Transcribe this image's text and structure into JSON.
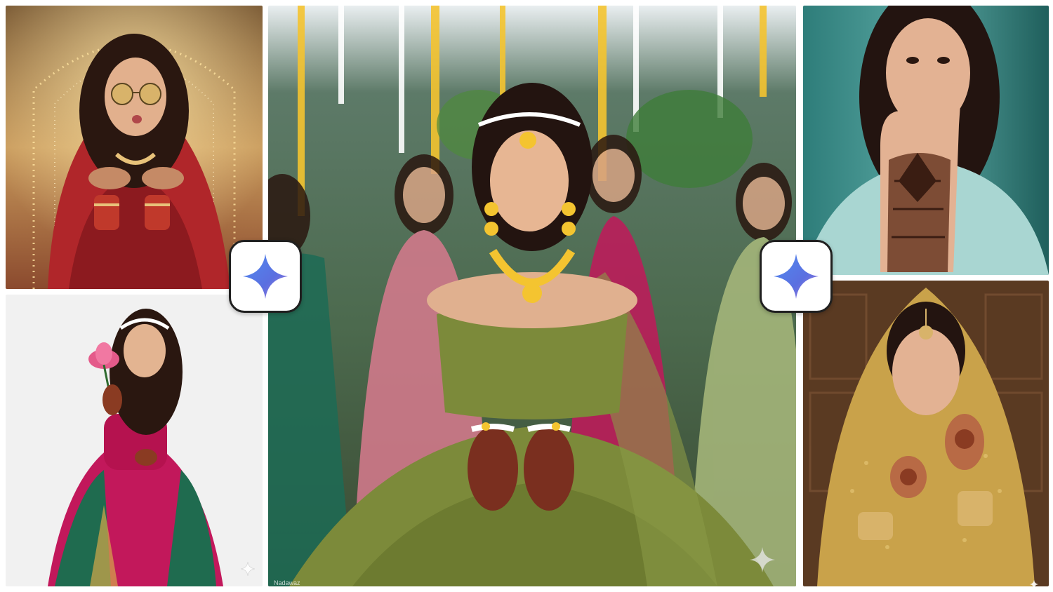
{
  "collage": {
    "photos": [
      {
        "subject": "bride-sunglasses-blowing-kiss",
        "palette": [
          "#b0262a",
          "#e8c27a",
          "#3a1d12"
        ]
      },
      {
        "subject": "bride-holding-lotus",
        "palette": [
          "#c2185b",
          "#1f6b4f",
          "#f2f2f2"
        ]
      },
      {
        "subject": "bride-olive-lehenga-showing-henna",
        "palette": [
          "#7c8a3a",
          "#f4c430",
          "#3d5a3b"
        ]
      },
      {
        "subject": "woman-showing-henna-hand",
        "palette": [
          "#a9d6d2",
          "#2e7d7a",
          "#6b3a25"
        ]
      },
      {
        "subject": "bride-gold-dupatta-henna",
        "palette": [
          "#c9a24a",
          "#5a3a22",
          "#8a5a2b"
        ]
      }
    ],
    "badges": [
      "sparkle-icon",
      "sparkle-icon"
    ],
    "watermark": "Nadawaz"
  }
}
